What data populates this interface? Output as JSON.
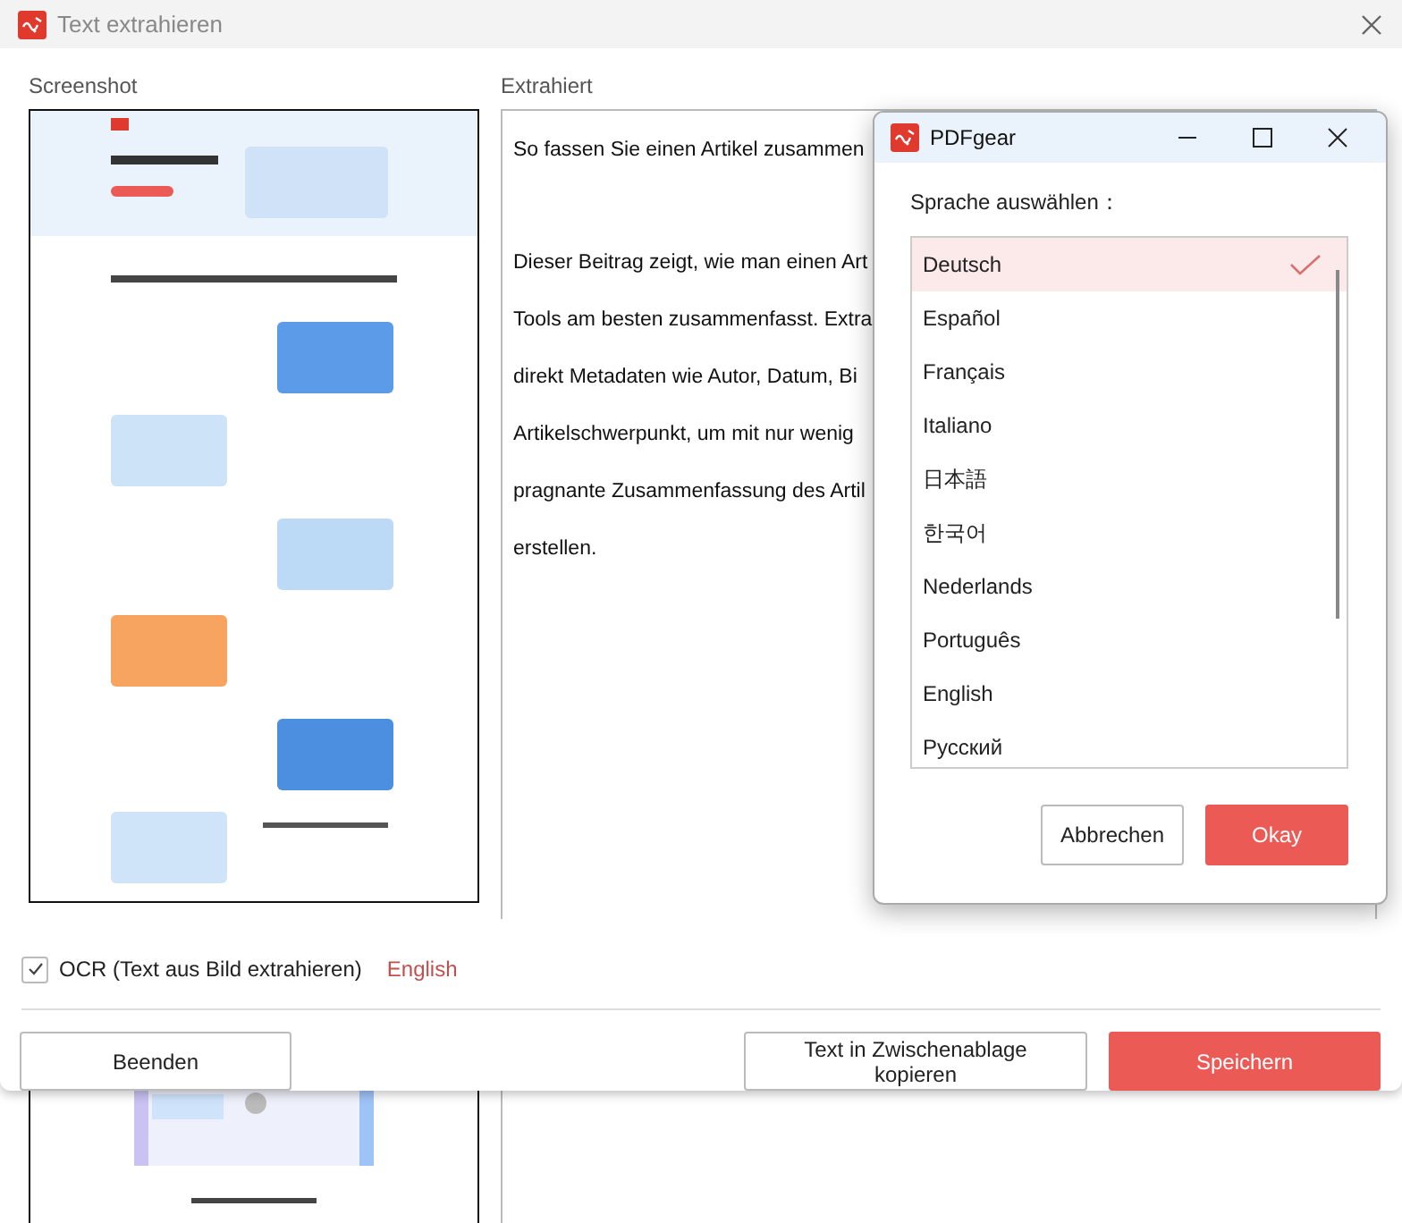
{
  "window": {
    "title": "Text extrahieren"
  },
  "screenshot_panel": {
    "label": "Screenshot"
  },
  "extracted_panel": {
    "label": "Extrahiert",
    "paragraphs": [
      {
        "lines": [
          "So fassen Sie einen Artikel zusammen"
        ]
      },
      {
        "lines": [
          "Dieser Beitrag zeigt, wie man einen Art",
          "Tools am besten zusammenfasst. Extra",
          "direkt Metadaten wie Autor, Datum, Bi",
          "Artikelschwerpunkt, um mit nur wenig",
          "pragnante Zusammenfassung des Artil",
          "erstellen."
        ]
      }
    ]
  },
  "ocr": {
    "label": "OCR (Text aus Bild extrahieren)",
    "checked": true,
    "language": "English"
  },
  "buttons": {
    "quit": "Beenden",
    "copy": "Text in Zwischenablage kopieren",
    "save": "Speichern"
  },
  "language_dialog": {
    "title": "PDFgear",
    "prompt": "Sprache auswählen：",
    "languages": [
      {
        "label": "Deutsch",
        "selected": true
      },
      {
        "label": "Español",
        "selected": false
      },
      {
        "label": "Français",
        "selected": false
      },
      {
        "label": "Italiano",
        "selected": false
      },
      {
        "label": "日本語",
        "selected": false
      },
      {
        "label": "한국어",
        "selected": false
      },
      {
        "label": "Nederlands",
        "selected": false
      },
      {
        "label": "Português",
        "selected": false
      },
      {
        "label": "English",
        "selected": false
      },
      {
        "label": "Русский",
        "selected": false
      }
    ],
    "cancel": "Abbrechen",
    "ok": "Okay"
  }
}
